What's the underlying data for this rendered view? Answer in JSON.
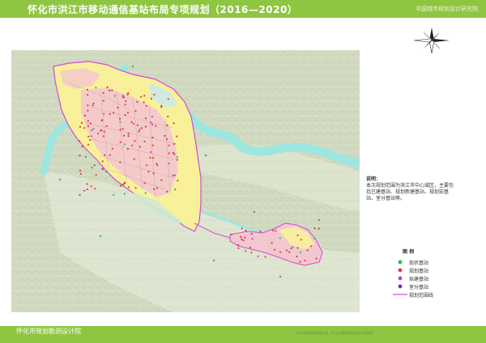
{
  "header": {
    "title": "怀化市洪江市移动通信基站布局专项规划（2016—2020）",
    "org": "中国城市规划设计研究院"
  },
  "footer": {
    "org": "怀化市规划勘测设计院",
    "note": "怀化市规划勘测设计院 · 洪江市通信基站布局专项规划"
  },
  "notes": {
    "title": "说明：",
    "text": "本次规划范围为洪江市中心城区，主要包括已建基站、规划新建基站、规划宏基站、室分基站等。"
  },
  "legend": {
    "title": "图 例",
    "items": [
      {
        "label": "现状基站",
        "color": "#2eb66b",
        "symbol": "dot-green"
      },
      {
        "label": "规划基站",
        "color": "#e03a3a",
        "symbol": "dot-red"
      },
      {
        "label": "拟建基站",
        "color": "#c23bd4",
        "symbol": "dot-purple"
      },
      {
        "label": "室分基站",
        "color": "#7a2bbd",
        "symbol": "dot-violet"
      },
      {
        "label": "规划范围线",
        "color": "#d44ad8",
        "symbol": "boundary-line"
      }
    ]
  },
  "colors": {
    "title_bar": "#8fc641",
    "terrain": "#cfd9be",
    "river": "#9ee6e0",
    "urban_land": "#f8f19a",
    "residential": "#f4c6cf",
    "boundary": "#d44ad8"
  }
}
